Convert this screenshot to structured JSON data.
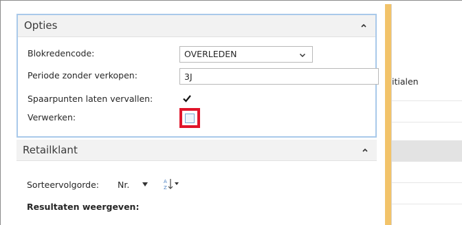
{
  "opties": {
    "title": "Opties",
    "fields": {
      "blokredencode": {
        "label": "Blokredencode:",
        "value": "OVERLEDEN"
      },
      "periode": {
        "label": "Periode zonder verkopen:",
        "value": "3J"
      },
      "spaarpunten": {
        "label": "Spaarpunten laten vervallen:",
        "checked": true
      },
      "verwerken": {
        "label": "Verwerken:",
        "checked": false
      }
    }
  },
  "retailklant": {
    "title": "Retailklant",
    "sort_label": "Sorteervolgorde:",
    "sort_value": "Nr.",
    "results_heading": "Resultaten weergeven:"
  },
  "background": {
    "column_header": "itialen"
  },
  "colors": {
    "highlight_red": "#e0142a",
    "section_border": "#a9c9ea",
    "yellow_bar": "#f2c36a"
  }
}
